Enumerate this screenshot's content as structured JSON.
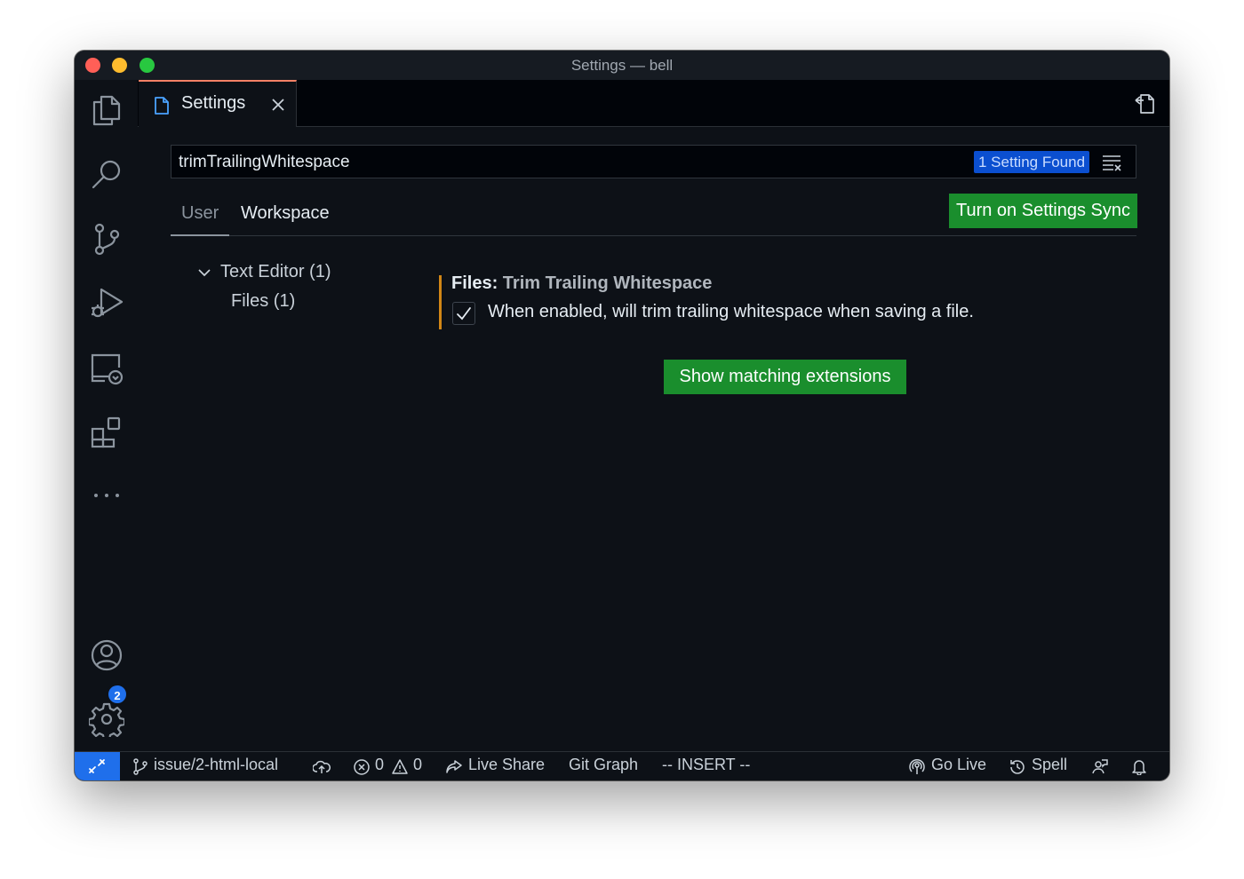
{
  "window": {
    "title": "Settings — bell"
  },
  "activity_bar": {
    "items": [
      "files-icon",
      "search-icon",
      "source-control-icon",
      "run-debug-icon",
      "remote-explorer-icon",
      "extensions-icon",
      "more-icon"
    ],
    "accounts_badge": "2"
  },
  "tab": {
    "label": "Settings"
  },
  "search": {
    "value": "trimTrailingWhitespace",
    "results": "1 Setting Found"
  },
  "scope_tabs": {
    "user": "User",
    "workspace": "Workspace"
  },
  "sync_button": "Turn on Settings Sync",
  "toc": {
    "text_editor": "Text Editor (1)",
    "files": "Files (1)"
  },
  "setting": {
    "category": "Files: ",
    "name": "Trim Trailing Whitespace",
    "description": "When enabled, will trim trailing whitespace when saving a file.",
    "checked": true
  },
  "extensions_button": "Show matching extensions",
  "status_bar": {
    "branch": "issue/2-html-local",
    "errors": "0",
    "warnings": "0",
    "live_share": "Live Share",
    "git_graph": "Git Graph",
    "mode": "-- INSERT --",
    "go_live": "Go Live",
    "spell": "Spell"
  },
  "colors": {
    "accent_green": "#1a8e2d",
    "accent_blue": "#1f6feb",
    "modified_bar": "#d18616",
    "background": "#0d1117"
  }
}
